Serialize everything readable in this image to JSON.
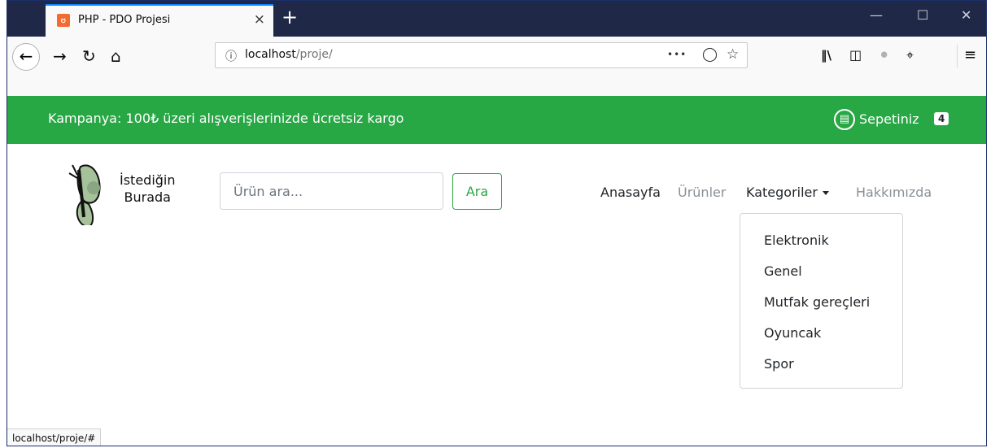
{
  "browser": {
    "tab_title": "PHP - PDO Projesi",
    "new_tab": "+",
    "tab_close": "×",
    "url_host": "localhost",
    "url_path": "/proje/",
    "page_actions_more": "•••",
    "window_controls": [
      "—",
      "☐",
      "✕"
    ]
  },
  "banner": {
    "campaign": "Kampanya: 100₺ üzeri alışverişlerinizde ücretsiz kargo",
    "cart_label": "Sepetiniz",
    "cart_count": "4"
  },
  "header": {
    "logo_line1": "İstediğin",
    "logo_line2": "Burada",
    "search_placeholder": "Ürün ara...",
    "search_button": "Ara"
  },
  "nav": {
    "home": "Anasayfa",
    "products": "Ürünler",
    "categories": "Kategoriler",
    "about": "Hakkımızda"
  },
  "dropdown": {
    "items": [
      "Elektronik",
      "Genel",
      "Mutfak gereçleri",
      "Oyuncak",
      "Spor"
    ]
  },
  "status": {
    "link": "localhost/proje/#"
  },
  "colors": {
    "accent_green": "#28a745",
    "titlebar": "#1f2846",
    "tab_accent": "#0a84ff"
  }
}
